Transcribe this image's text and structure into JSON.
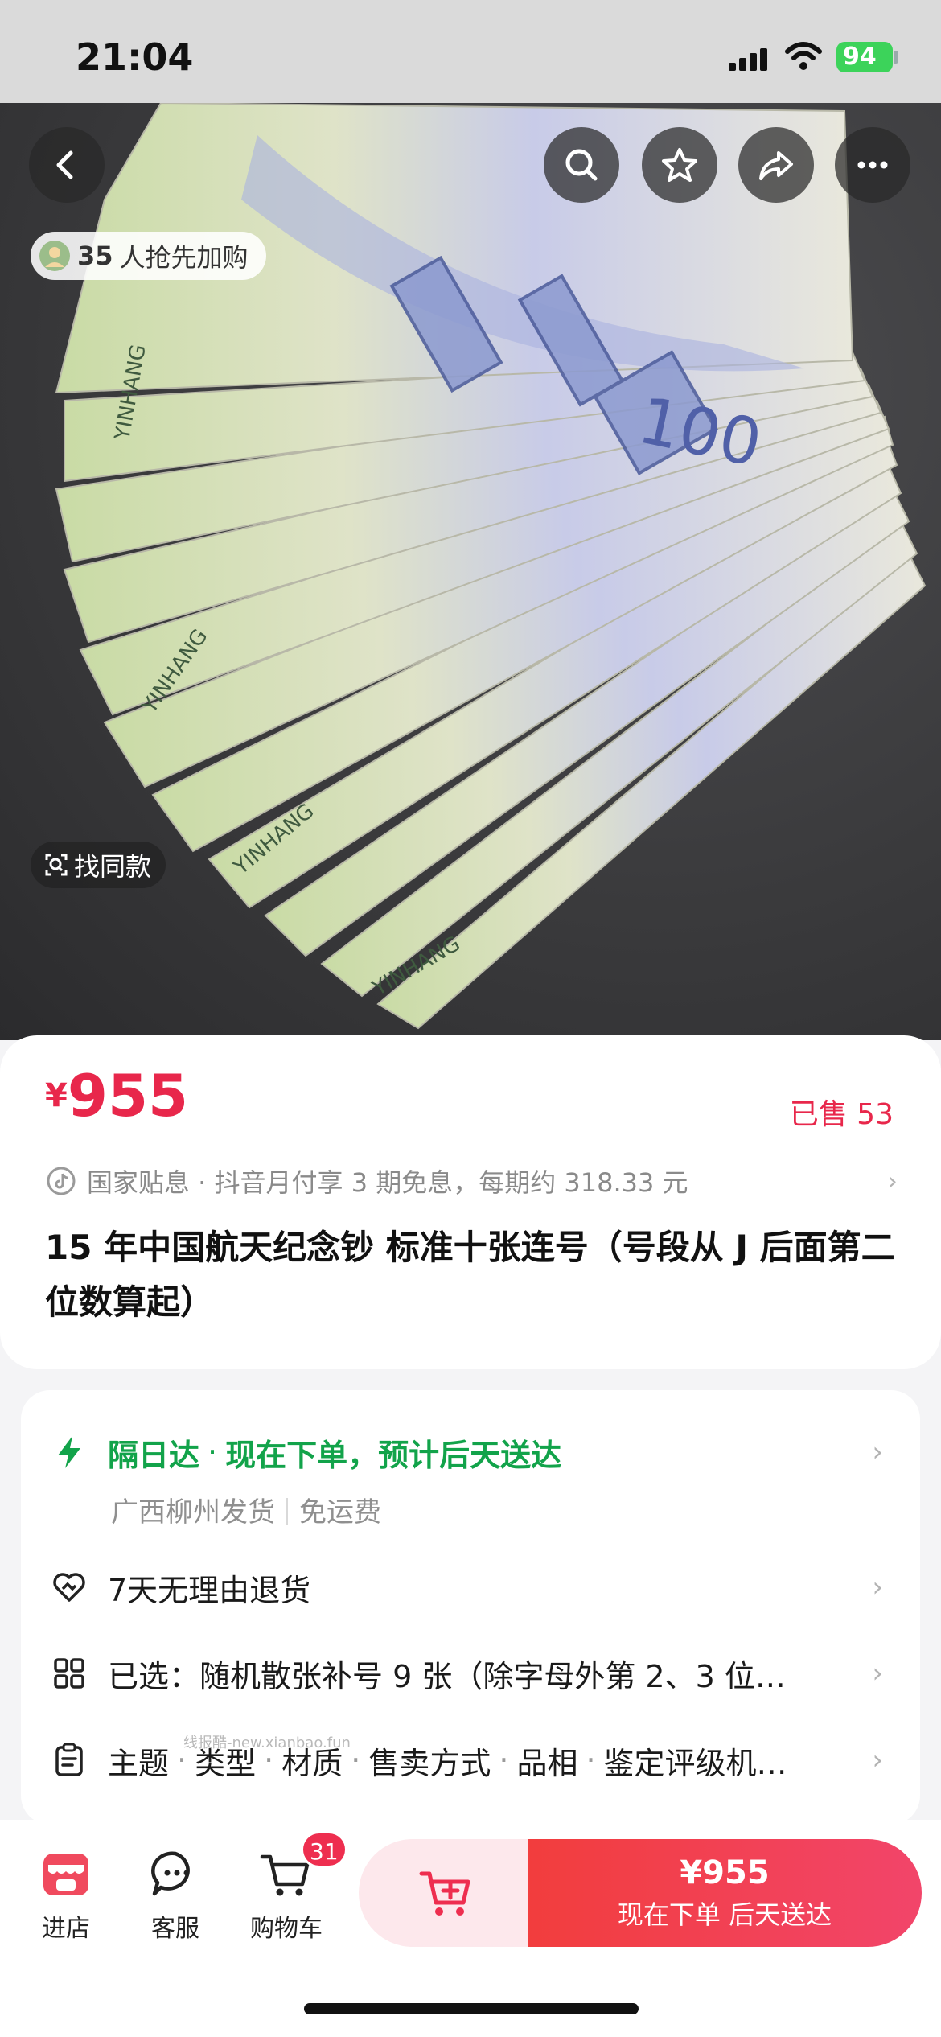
{
  "status": {
    "time": "21:04",
    "battery": "94"
  },
  "hero": {
    "preorder_count": "35",
    "preorder_text": "人抢先加购",
    "find_same_label": "找同款",
    "note_value": "100",
    "note_year": "2015",
    "note_bank": "YINHANG"
  },
  "product": {
    "currency": "¥",
    "price": "955",
    "sold": "已售 53",
    "promo": "国家贴息 · 抖音月付享 3 期免息，每期约 318.33 元",
    "title": "15 年中国航天纪念钞 标准十张连号（号段从 J 后面第二位数算起）"
  },
  "service": {
    "delivery_label": "隔日达",
    "delivery_text": "现在下单，预计后天送达",
    "ship_from": "广西柳州发货",
    "shipping_fee": "免运费",
    "returns": "7天无理由退货",
    "selected": "已选：随机散张补号 9 张（除字母外第 2、3 位…",
    "attributes": [
      "主题",
      "类型",
      "材质",
      "售卖方式",
      "品相",
      "鉴定评级机…"
    ]
  },
  "watermark": "线报酷-new.xianbao.fun",
  "bottom": {
    "store": "进店",
    "service": "客服",
    "cart": "购物车",
    "cart_count": "31",
    "buy_price": "¥955",
    "buy_sub": "现在下单  后天送达"
  },
  "colors": {
    "accent": "#e8274b",
    "green": "#12a34a"
  }
}
